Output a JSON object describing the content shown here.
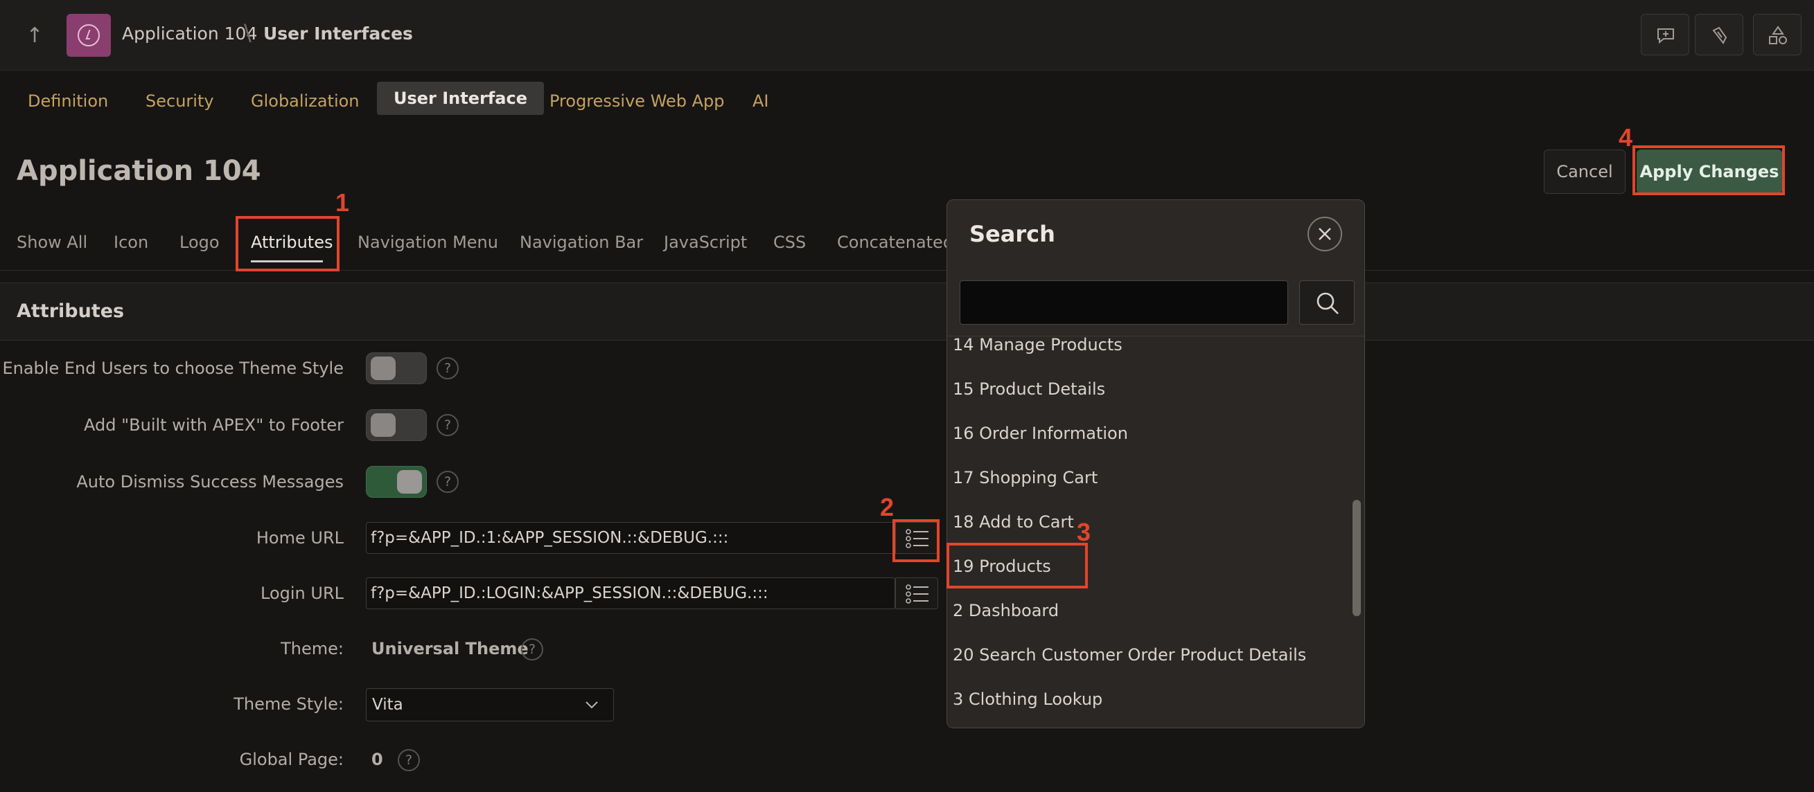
{
  "header": {
    "crumb_app": "Application 104",
    "crumb_separator": "\\",
    "crumb_page": "User Interfaces"
  },
  "primary_tabs": [
    "Definition",
    "Security",
    "Globalization",
    "User Interface",
    "Progressive Web App",
    "AI"
  ],
  "page": {
    "title": "Application 104",
    "cancel_label": "Cancel",
    "apply_label": "Apply Changes"
  },
  "secondary_tabs": [
    "Show All",
    "Icon",
    "Logo",
    "Attributes",
    "Navigation Menu",
    "Navigation Bar",
    "JavaScript",
    "CSS",
    "Concatenated"
  ],
  "section": {
    "title": "Attributes",
    "fields": {
      "theme_style_toggle_label": "Enable End Users to choose Theme Style",
      "built_with_label": "Add \"Built with APEX\" to Footer",
      "auto_dismiss_label": "Auto Dismiss Success Messages",
      "home_url_label": "Home URL",
      "home_url_value": "f?p=&APP_ID.:1:&APP_SESSION.::&DEBUG.:::",
      "login_url_label": "Login URL",
      "login_url_value": "f?p=&APP_ID.:LOGIN:&APP_SESSION.::&DEBUG.:::",
      "theme_label": "Theme:",
      "theme_value": "Universal Theme",
      "theme_style_label": "Theme Style:",
      "theme_style_value": "Vita",
      "global_page_label": "Global Page:",
      "global_page_value": "0"
    },
    "toggles": {
      "theme_style": false,
      "built_with": false,
      "auto_dismiss": true
    },
    "help_glyph": "?"
  },
  "dialog": {
    "title": "Search",
    "items": [
      "14 Manage Products",
      "15 Product Details",
      "16 Order Information",
      "17 Shopping Cart",
      "18 Add to Cart",
      "19 Products",
      "2 Dashboard",
      "20 Search Customer Order Product Details",
      "3 Clothing Lookup"
    ]
  },
  "annotations": [
    "1",
    "2",
    "3",
    "4"
  ],
  "colors": {
    "accent_gold": "#c6a25e",
    "apply_green": "#3c5a43",
    "annotation_red": "#e2452c",
    "app_badge": "#8a3e6e"
  }
}
